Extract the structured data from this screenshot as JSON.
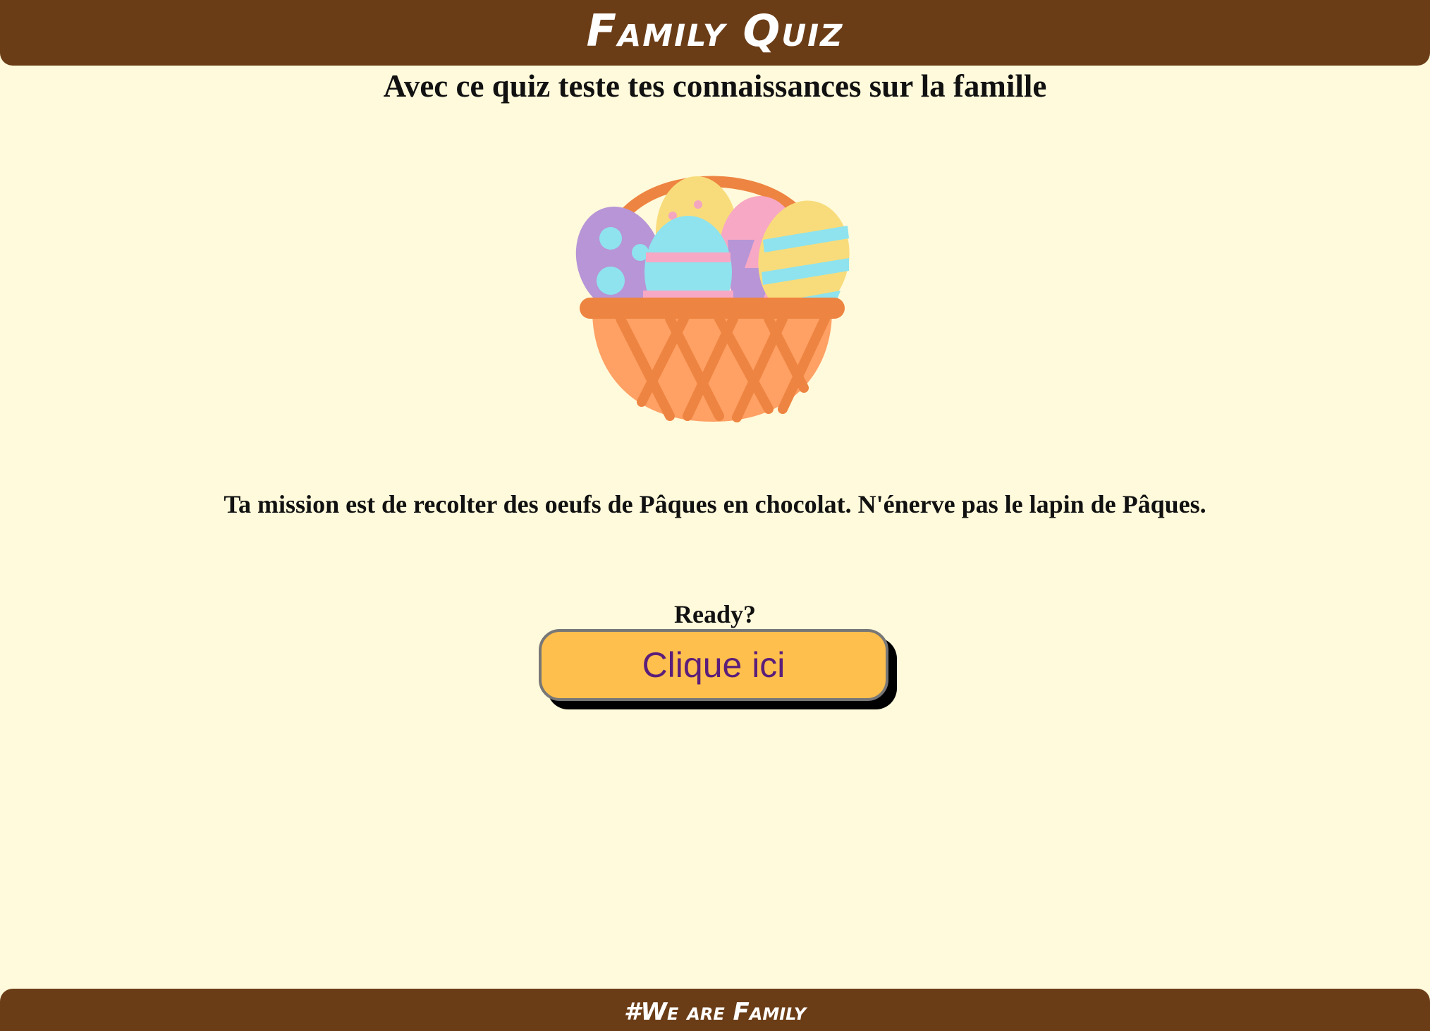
{
  "header": {
    "title": "Family Quiz"
  },
  "intro": {
    "subtitle": "Avec ce quiz teste tes connaissances sur la famille"
  },
  "illustration": {
    "icon": "easter-basket-icon"
  },
  "mission": {
    "text": "Ta mission est de recolter des oeufs de Pâques en chocolat. N'énerve pas le lapin de Pâques."
  },
  "prompt": {
    "ready": "Ready?"
  },
  "start_button": {
    "label": "Clique ici"
  },
  "footer": {
    "text": "#We are Family"
  },
  "colors": {
    "background": "#fffadb",
    "bar": "#6b3d17",
    "button": "#ffbf4c",
    "button_text": "#5b1e7a",
    "basket": "#ee8441",
    "basket_light": "#ffa064"
  }
}
